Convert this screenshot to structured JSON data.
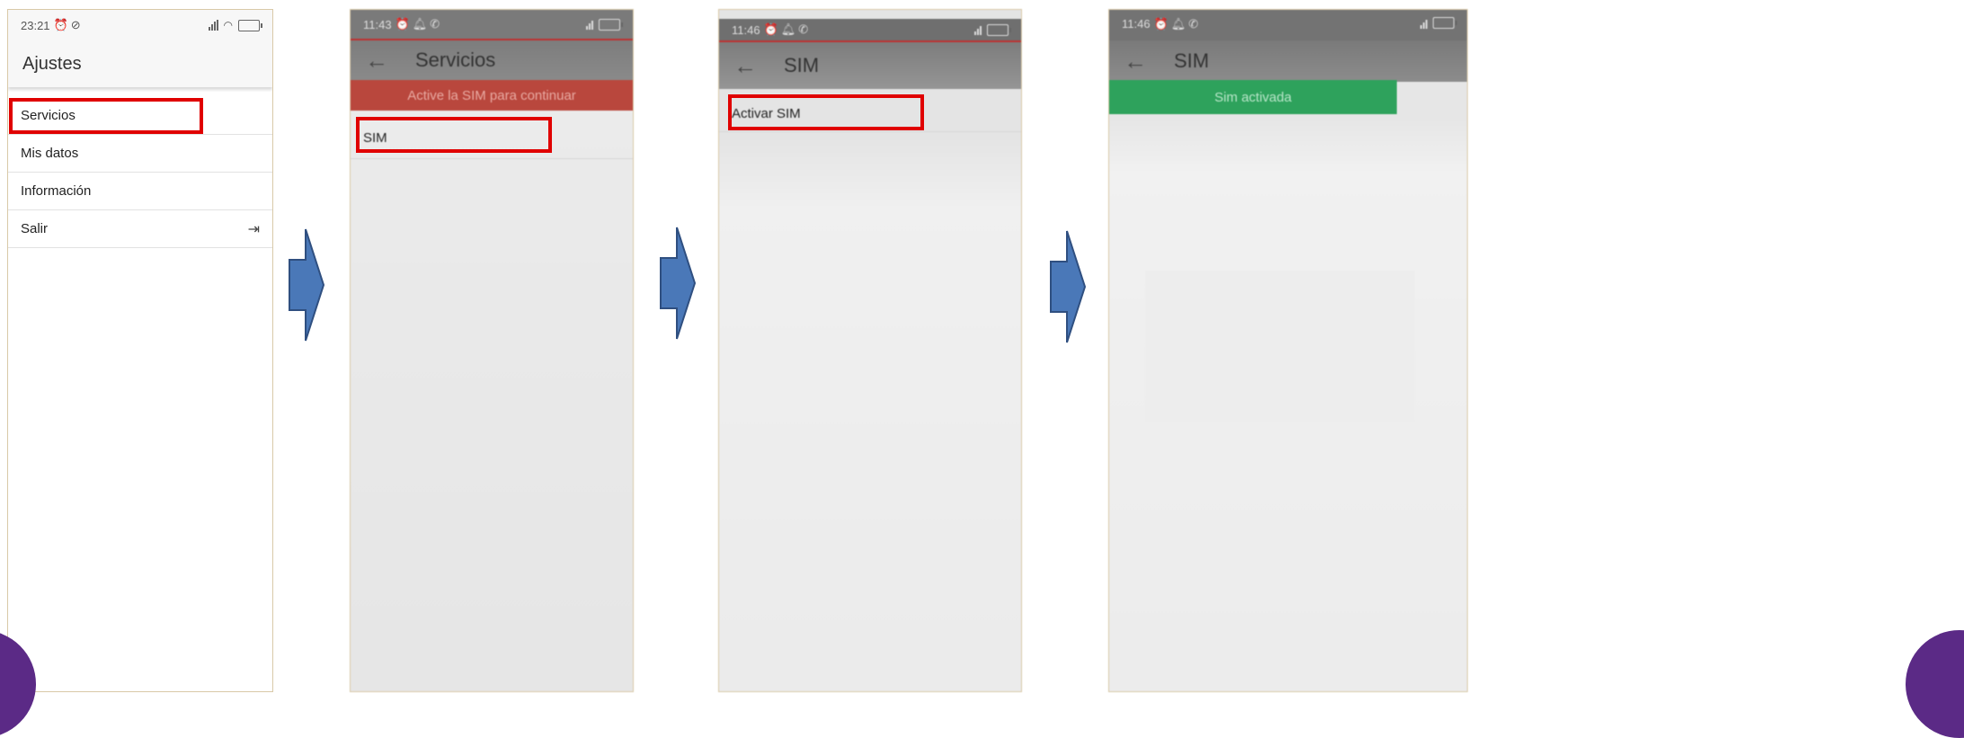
{
  "colors": {
    "highlight": "#e00000",
    "arrow_fill": "#4a78b8",
    "banner_red": "#b9473d",
    "banner_green": "#2ea25c"
  },
  "screens": [
    {
      "status_time": "23:21",
      "title": "Ajustes",
      "menu": [
        {
          "label": "Servicios",
          "icon": ""
        },
        {
          "label": "Mis datos",
          "icon": ""
        },
        {
          "label": "Información",
          "icon": ""
        },
        {
          "label": "Salir",
          "icon": "logout-icon"
        }
      ]
    },
    {
      "status_time": "11:43",
      "title": "Servicios",
      "banner": "Active la SIM para continuar",
      "items": [
        "SIM"
      ]
    },
    {
      "status_time": "11:46",
      "title": "SIM",
      "items": [
        "Activar SIM"
      ]
    },
    {
      "status_time": "11:46",
      "title": "SIM",
      "banner": "Sim activada"
    }
  ]
}
